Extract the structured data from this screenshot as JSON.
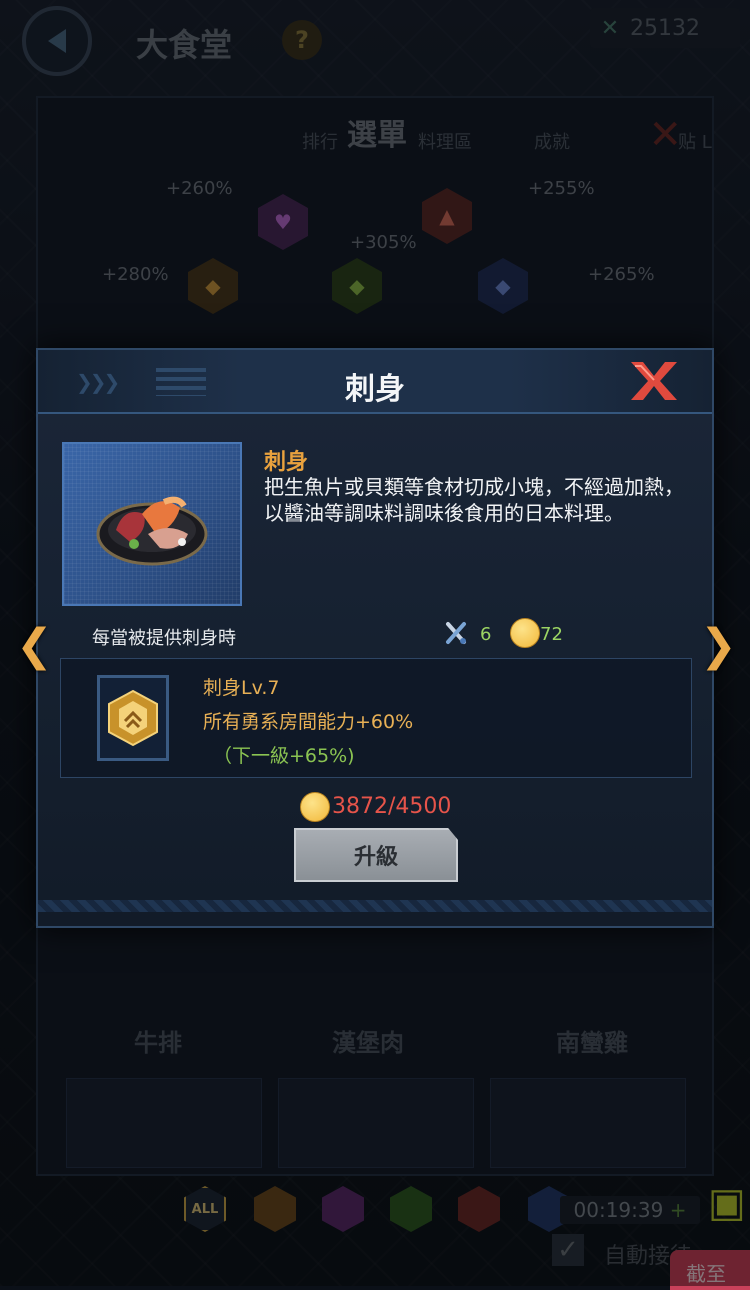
{
  "background": {
    "hall_title": "大食堂",
    "help_label": "?",
    "coin_value": "25132",
    "menu_title": "選單",
    "menu_tabs": [
      "排行",
      "料理區",
      "成就",
      "贴 L"
    ],
    "bonuses": [
      "+260%",
      "+255%",
      "+305%",
      "+280%",
      "+265%"
    ],
    "dish_labels": [
      "牛排",
      "漢堡肉",
      "南蠻雞"
    ],
    "filter_all_label": "ALL",
    "timer": "00:19:39",
    "timer_plus": "+",
    "auto_label": "自動接待",
    "jump_label": "截至"
  },
  "dialog": {
    "title": "刺身",
    "food_name": "刺身",
    "food_description": "把生魚片或貝類等食材切成小塊，不經過加熱，以醬油等調味料調味後食用的日本料理。",
    "trigger_text": "每當被提供刺身時",
    "stat_serve_value": "6",
    "stat_happy_value": "72",
    "skill": {
      "name": "刺身Lv.7",
      "effect": "所有勇系房間能力+60%",
      "next_level": "（下一級+65%)"
    },
    "cost": "3872/4500",
    "upgrade_label": "升級"
  },
  "colors": {
    "accent_orange": "#e9a23e",
    "green_value": "#9bd463",
    "cost_red": "#e6544a",
    "close_red": "#e04a3e"
  }
}
